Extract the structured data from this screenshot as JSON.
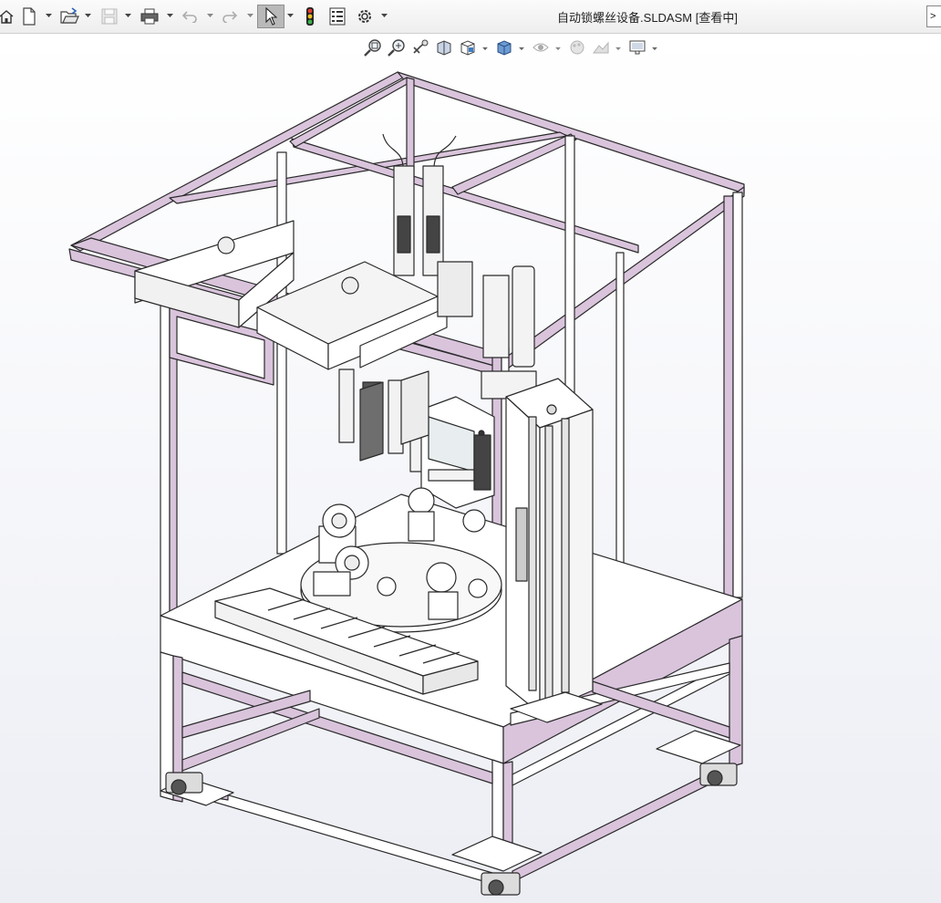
{
  "window": {
    "title": "自动锁螺丝设备.SLDASM [查看中]"
  },
  "toolbar": {
    "buttons": [
      {
        "name": "home-icon",
        "dropdown": false
      },
      {
        "name": "new-document-icon",
        "dropdown": true
      },
      {
        "name": "open-folder-icon",
        "dropdown": true
      },
      {
        "name": "save-icon",
        "dropdown": true,
        "disabled": true
      },
      {
        "name": "print-icon",
        "dropdown": true
      },
      {
        "name": "undo-icon",
        "dropdown": true,
        "disabled": true
      },
      {
        "name": "redo-icon",
        "dropdown": true,
        "disabled": true
      },
      {
        "name": "select-cursor-icon",
        "dropdown": true,
        "active": true
      },
      {
        "name": "traffic-light-icon",
        "dropdown": false
      },
      {
        "name": "properties-list-icon",
        "dropdown": false
      },
      {
        "name": "options-gear-icon",
        "dropdown": true
      }
    ],
    "edge_label": ">"
  },
  "heads_up_toolbar": {
    "buttons": [
      {
        "name": "zoom-to-fit-icon"
      },
      {
        "name": "zoom-to-area-icon"
      },
      {
        "name": "previous-view-icon"
      },
      {
        "name": "section-view-icon"
      },
      {
        "name": "view-orientation-icon",
        "dropdown": true
      },
      {
        "name": "display-style-icon",
        "dropdown": true
      },
      {
        "name": "hide-show-items-icon",
        "dropdown": true
      },
      {
        "name": "edit-appearance-icon"
      },
      {
        "name": "apply-scene-icon",
        "dropdown": true
      },
      {
        "name": "view-settings-icon",
        "dropdown": true
      }
    ]
  },
  "colors": {
    "frame_fill": "#d9c4dc",
    "frame_edge": "#2a2a2a",
    "part_fill": "#ffffff",
    "screen_fill": "#e8eef0",
    "toolbar_bg": "#f2f2f2",
    "active_button": "#b9b9b9"
  },
  "model": {
    "name": "自动锁螺丝设备"
  }
}
